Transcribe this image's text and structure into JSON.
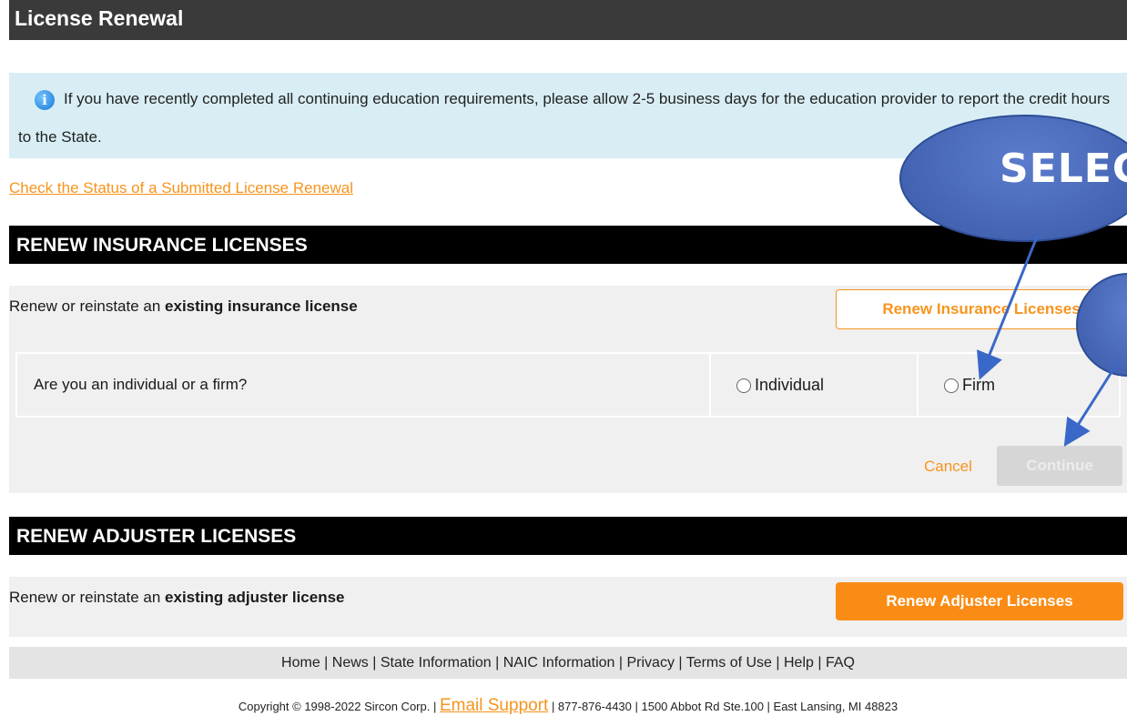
{
  "page": {
    "title": "License Renewal"
  },
  "info": {
    "icon": "info-icon",
    "message": "If you have recently completed all continuing education requirements, please allow 2-5 business days for the education provider to report the credit hours to the State."
  },
  "status_link": "Check the Status of a Submitted License Renewal",
  "insurance": {
    "header": "RENEW INSURANCE LICENSES",
    "text_prefix": "Renew or reinstate an ",
    "text_bold": "existing insurance license",
    "button": "Renew Insurance Licenses",
    "question": "Are you an individual or a firm?",
    "option_individual": "Individual",
    "option_firm": "Firm",
    "cancel": "Cancel",
    "continue": "Continue"
  },
  "adjuster": {
    "header": "RENEW ADJUSTER LICENSES",
    "text_prefix": "Renew or reinstate an ",
    "text_bold": "existing adjuster license",
    "button": "Renew Adjuster Licenses"
  },
  "footer": {
    "links": [
      "Home",
      "News",
      "State Information",
      "NAIC Information",
      "Privacy",
      "Terms of Use",
      "Help",
      "FAQ"
    ],
    "copyright": "Copyright © 1998-2022 Sircon Corp. |",
    "email": "Email Support",
    "contact": "| 877-876-4430 | 1500 Abbot Rd Ste.100 | East Lansing, MI 48823"
  },
  "annotation": {
    "callout": "SELECT"
  },
  "colors": {
    "accent": "#f7941d",
    "header_bg": "#000000",
    "info_bg": "#d8eef4"
  }
}
